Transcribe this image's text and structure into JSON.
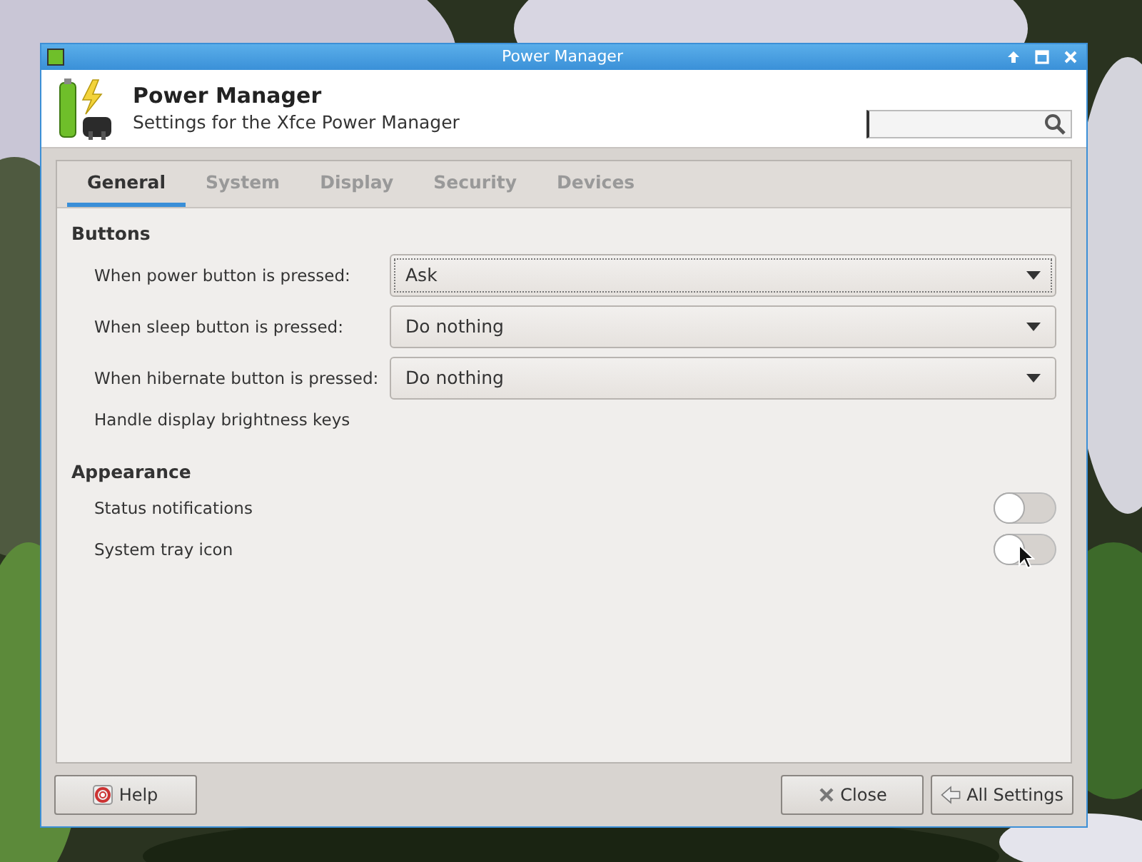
{
  "window": {
    "title": "Power Manager"
  },
  "header": {
    "title": "Power Manager",
    "subtitle": "Settings for the Xfce Power Manager"
  },
  "tabs": [
    {
      "label": "General",
      "selected": true
    },
    {
      "label": "System",
      "selected": false
    },
    {
      "label": "Display",
      "selected": false
    },
    {
      "label": "Security",
      "selected": false
    },
    {
      "label": "Devices",
      "selected": false
    }
  ],
  "sections": [
    {
      "heading": "Buttons",
      "rows": [
        {
          "kind": "dropdown",
          "label": "When power button is pressed:",
          "value": "Ask",
          "focused": true
        },
        {
          "kind": "dropdown",
          "label": "When sleep button is pressed:",
          "value": "Do nothing",
          "focused": false
        },
        {
          "kind": "dropdown",
          "label": "When hibernate button is pressed:",
          "value": "Do nothing",
          "focused": false
        },
        {
          "kind": "text",
          "label": "Handle display brightness keys"
        }
      ]
    },
    {
      "heading": "Appearance",
      "rows": [
        {
          "kind": "switch",
          "label": "Status notifications",
          "on": false
        },
        {
          "kind": "switch",
          "label": "System tray icon",
          "on": false
        }
      ]
    }
  ],
  "buttons": [
    {
      "kind": "help",
      "label": "Help"
    },
    {
      "kind": "close",
      "label": "Close"
    },
    {
      "kind": "back",
      "label": "All Settings"
    }
  ]
}
